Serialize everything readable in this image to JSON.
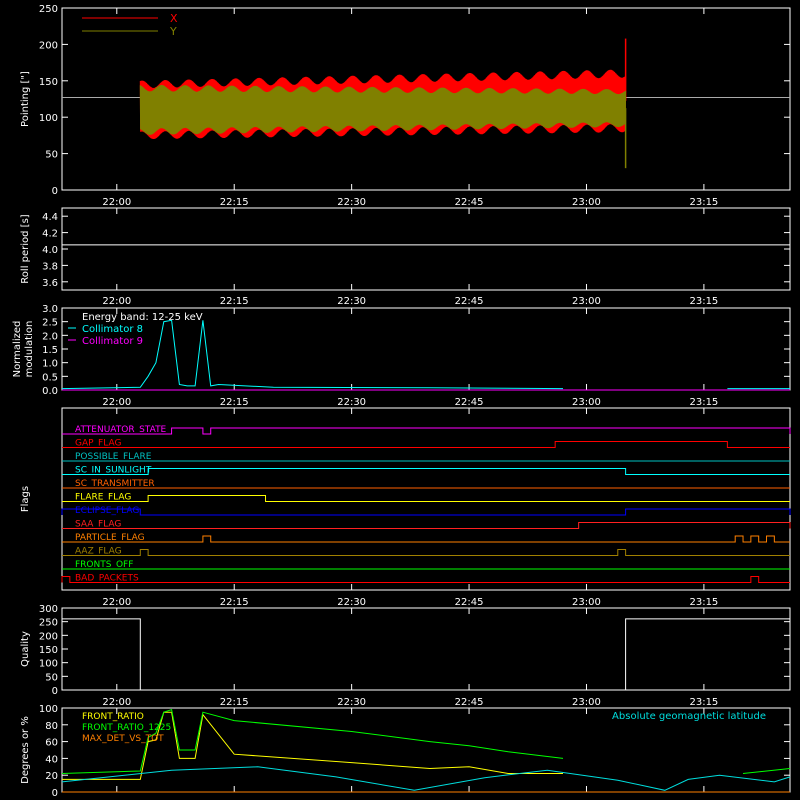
{
  "chart_data": [
    {
      "type": "line",
      "ylabel": "Pointing [\"]",
      "ylim": [
        0,
        250
      ],
      "yticks": [
        "0",
        "50",
        "100",
        "150",
        "200",
        "250"
      ],
      "xticks": [
        "22:00",
        "22:15",
        "22:30",
        "22:45",
        "23:00",
        "23:15"
      ],
      "legend": {
        "placement": "top-left",
        "entries": [
          "X",
          "Y"
        ]
      },
      "series": [
        {
          "name": "X",
          "color": "#ff0000",
          "start": "22:03",
          "end": "23:05",
          "low_start": 75,
          "high_start": 145,
          "low_end": 85,
          "high_end": 160,
          "spike": 208
        },
        {
          "name": "Y",
          "color": "#808000",
          "start": "22:03",
          "end": "23:05",
          "low_start": 80,
          "high_start": 140,
          "low_end": 90,
          "high_end": 135,
          "spike": 30
        }
      ],
      "reference_line": 127
    },
    {
      "type": "line",
      "ylabel": "Roll period [s]",
      "ylim": [
        3.5,
        4.5
      ],
      "yticks": [
        "3.6",
        "3.8",
        "4.0",
        "4.2",
        "4.4"
      ],
      "xticks": [
        "22:00",
        "22:15",
        "22:30",
        "22:45",
        "23:00",
        "23:15"
      ],
      "series": [
        {
          "name": "",
          "color": "#ffffff",
          "value": 4.05
        }
      ]
    },
    {
      "type": "line",
      "ylabel": "Normalized modulation",
      "ylim": [
        0,
        3.0
      ],
      "yticks": [
        "0.0",
        "0.5",
        "1.0",
        "1.5",
        "2.0",
        "2.5",
        "3.0"
      ],
      "xticks": [
        "22:00",
        "22:15",
        "22:30",
        "22:45",
        "23:00",
        "23:15"
      ],
      "legend": {
        "placement": "top-left",
        "entries": [
          "Energy band: 12-25 keV",
          "Collimator 8",
          "Collimator 9"
        ]
      },
      "series": [
        {
          "name": "Collimator 8",
          "color": "#00ffff",
          "x": [
            "21:53",
            "22:03",
            "22:04",
            "22:05",
            "22:06",
            "22:07",
            "22:08",
            "22:09",
            "22:10",
            "22:11",
            "22:12",
            "22:13",
            "22:20",
            "22:40",
            "22:57"
          ],
          "y": [
            0.05,
            0.1,
            0.5,
            1.0,
            2.5,
            2.55,
            0.2,
            0.15,
            0.15,
            2.55,
            0.15,
            0.2,
            0.1,
            0.08,
            0.05
          ]
        },
        {
          "name": "Collimator 9",
          "color": "#ff00ff",
          "x": [
            "21:53",
            "23:26"
          ],
          "y": [
            0,
            0
          ]
        }
      ]
    },
    {
      "type": "line",
      "ylabel": "Flags",
      "xticks": [
        "22:00",
        "22:15",
        "22:30",
        "22:45",
        "23:00",
        "23:15"
      ],
      "flags": [
        {
          "name": "ATTENUATOR_STATE",
          "color": "#ff00ff",
          "on": [
            [
              "22:07",
              "22:11"
            ],
            [
              "22:12",
              "23:26"
            ]
          ]
        },
        {
          "name": "GAP_FLAG",
          "color": "#ff0000",
          "on": [
            [
              "22:56",
              "23:18"
            ]
          ]
        },
        {
          "name": "POSSIBLE_FLARE",
          "color": "#00c0c0",
          "on": []
        },
        {
          "name": "SC_IN_SUNLIGHT",
          "color": "#00ffff",
          "on": [
            [
              "22:04",
              "23:05"
            ]
          ]
        },
        {
          "name": "SC_TRANSMITTER",
          "color": "#ff6000",
          "on": []
        },
        {
          "name": "FLARE_FLAG",
          "color": "#ffff00",
          "on": [
            [
              "22:04",
              "22:19"
            ]
          ]
        },
        {
          "name": "ECLIPSE_FLAG",
          "color": "#0000ff",
          "on": [
            [
              "21:53",
              "22:03"
            ],
            [
              "23:05",
              "23:26"
            ]
          ]
        },
        {
          "name": "SAA_FLAG",
          "color": "#ff2020",
          "on": [
            [
              "22:59",
              "23:26"
            ]
          ]
        },
        {
          "name": "PARTICLE_FLAG",
          "color": "#ff8000",
          "on": [
            [
              "22:11",
              "22:12"
            ],
            [
              "23:19",
              "23:20"
            ],
            [
              "23:21",
              "23:22"
            ],
            [
              "23:23",
              "23:24"
            ]
          ]
        },
        {
          "name": "AAZ_FLAG",
          "color": "#a08000",
          "on": [
            [
              "22:03",
              "22:04"
            ],
            [
              "23:04",
              "23:05"
            ]
          ]
        },
        {
          "name": "FRONTS_OFF",
          "color": "#00ff00",
          "on": []
        },
        {
          "name": "BAD_PACKETS",
          "color": "#ff0000",
          "on": [
            [
              "21:53",
              "21:54"
            ],
            [
              "23:21",
              "23:22"
            ]
          ]
        }
      ]
    },
    {
      "type": "line",
      "ylabel": "Quality",
      "ylim": [
        0,
        300
      ],
      "yticks": [
        "0",
        "50",
        "100",
        "150",
        "200",
        "250",
        "300"
      ],
      "xticks": [
        "22:00",
        "22:15",
        "22:30",
        "22:45",
        "23:00",
        "23:15"
      ],
      "series": [
        {
          "name": "",
          "color": "#ffffff",
          "x": [
            "21:53",
            "22:03",
            "22:03",
            "23:05",
            "23:05",
            "23:26"
          ],
          "y": [
            260,
            260,
            0,
            0,
            260,
            260
          ]
        }
      ]
    },
    {
      "type": "line",
      "ylabel": "Degrees or %",
      "ylim": [
        0,
        100
      ],
      "yticks": [
        "0",
        "20",
        "40",
        "60",
        "80",
        "100"
      ],
      "xticks": [
        "22:00",
        "22:15",
        "22:30",
        "22:45",
        "23:00",
        "23:15"
      ],
      "legend": {
        "placement": "top-left",
        "entries": [
          "FRONT_RATIO",
          "FRONT_RATIO_1225",
          "MAX_DET_VS_TOT"
        ]
      },
      "annotation": "Absolute geomagnetic latitude",
      "series": [
        {
          "name": "FRONT_RATIO",
          "color": "#ffff00",
          "x": [
            "21:53",
            "22:03",
            "22:04",
            "22:05",
            "22:06",
            "22:07",
            "22:08",
            "22:10",
            "22:11",
            "22:15",
            "22:30",
            "22:40",
            "22:45",
            "22:50",
            "22:57"
          ],
          "y": [
            15,
            15,
            60,
            62,
            95,
            95,
            40,
            40,
            92,
            45,
            35,
            28,
            30,
            22,
            22
          ]
        },
        {
          "name": "FRONT_RATIO_1225",
          "color": "#00ff00",
          "x": [
            "21:53",
            "22:03",
            "22:04",
            "22:05",
            "22:06",
            "22:07",
            "22:08",
            "22:10",
            "22:11",
            "22:15",
            "22:30",
            "22:40",
            "22:45",
            "22:50",
            "22:57",
            "23:18",
            "23:20",
            "23:26"
          ],
          "y": [
            22,
            25,
            65,
            70,
            95,
            98,
            50,
            50,
            95,
            85,
            72,
            60,
            55,
            48,
            40,
            null,
            22,
            28
          ]
        },
        {
          "name": "MAX_DET_VS_TOT",
          "color": "#ff8000",
          "x": [
            "21:53",
            "23:26"
          ],
          "y": [
            0,
            0
          ]
        },
        {
          "name": "Absolute geomagnetic latitude",
          "color": "#00dddd",
          "x": [
            "21:53",
            "22:07",
            "22:18",
            "22:28",
            "22:38",
            "22:47",
            "22:55",
            "23:04",
            "23:10",
            "23:13",
            "23:17",
            "23:24",
            "23:26"
          ],
          "y": [
            12,
            26,
            30,
            18,
            2,
            17,
            26,
            14,
            2,
            15,
            20,
            12,
            18
          ]
        }
      ]
    }
  ]
}
